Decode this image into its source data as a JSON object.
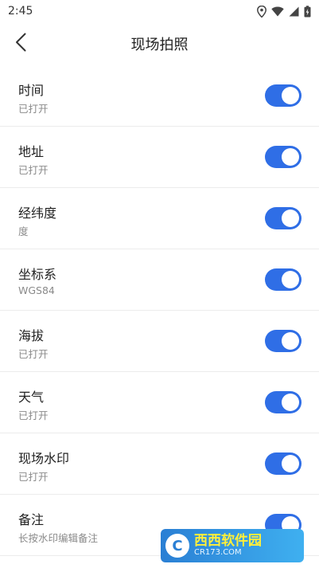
{
  "status": {
    "time": "2:45"
  },
  "header": {
    "title": "现场拍照"
  },
  "items": [
    {
      "title": "时间",
      "subtitle": "已打开",
      "on": true
    },
    {
      "title": "地址",
      "subtitle": "已打开",
      "on": true
    },
    {
      "title": "经纬度",
      "subtitle": "度",
      "on": true
    },
    {
      "title": "坐标系",
      "subtitle": "WGS84",
      "on": true
    },
    {
      "title": "海拔",
      "subtitle": "已打开",
      "on": true
    },
    {
      "title": "天气",
      "subtitle": "已打开",
      "on": true
    },
    {
      "title": "现场水印",
      "subtitle": "已打开",
      "on": true
    },
    {
      "title": "备注",
      "subtitle": "长按水印编辑备注",
      "on": true
    }
  ],
  "watermark": {
    "main": "西西软件园",
    "sub": "CR173.COM"
  },
  "colors": {
    "accent": "#2f6ee6"
  }
}
